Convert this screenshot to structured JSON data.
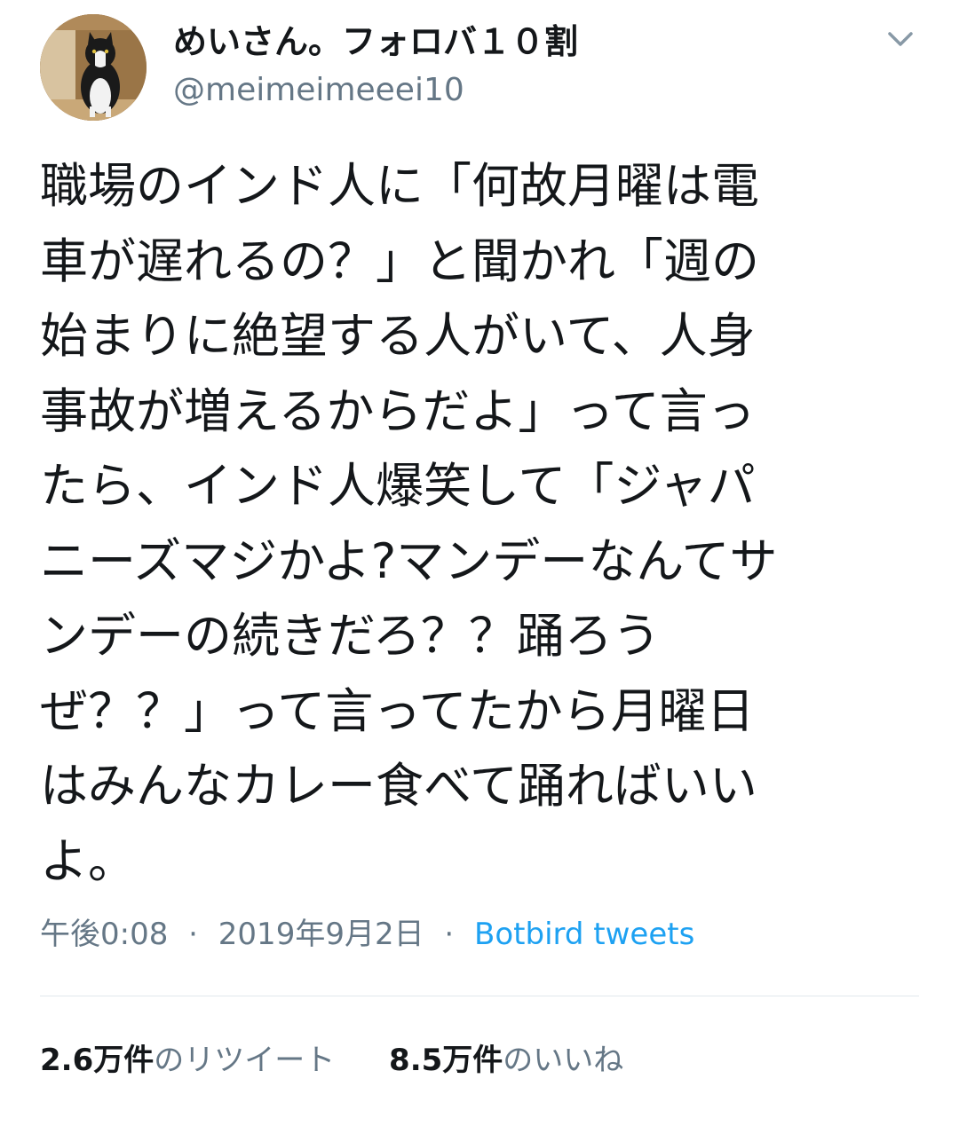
{
  "author": {
    "display_name": "めいさん。フォロバ１０割",
    "handle": "@meimeimeeei10",
    "avatar_icon": "cat-photo-avatar"
  },
  "menu_icon": "chevron-down-icon",
  "tweet": {
    "text": "職場のインド人に「何故月曜は電\n車が遅れるの？」と聞かれ「週の\n始まりに絶望する人がいて、人身\n事故が増えるからだよ」って言っ\nたら、インド人爆笑して「ジャパ\nニーズマジかよ?マンデーなんてサ\nンデーの続きだろ？？踊ろう\nぜ？？」って言ってたから月曜日\nはみんなカレー食べて踊ればいい\nよ。",
    "time": "午後0:08",
    "date": "2019年9月2日",
    "separator": "·",
    "source": "Botbird tweets"
  },
  "stats": {
    "retweets_count": "2.6万件",
    "retweets_label": "のリツイート",
    "likes_count": "8.5万件",
    "likes_label": "のいいね"
  },
  "colors": {
    "text": "#14171a",
    "secondary": "#657786",
    "link": "#1da1f2",
    "divider": "#e1e8ed"
  }
}
